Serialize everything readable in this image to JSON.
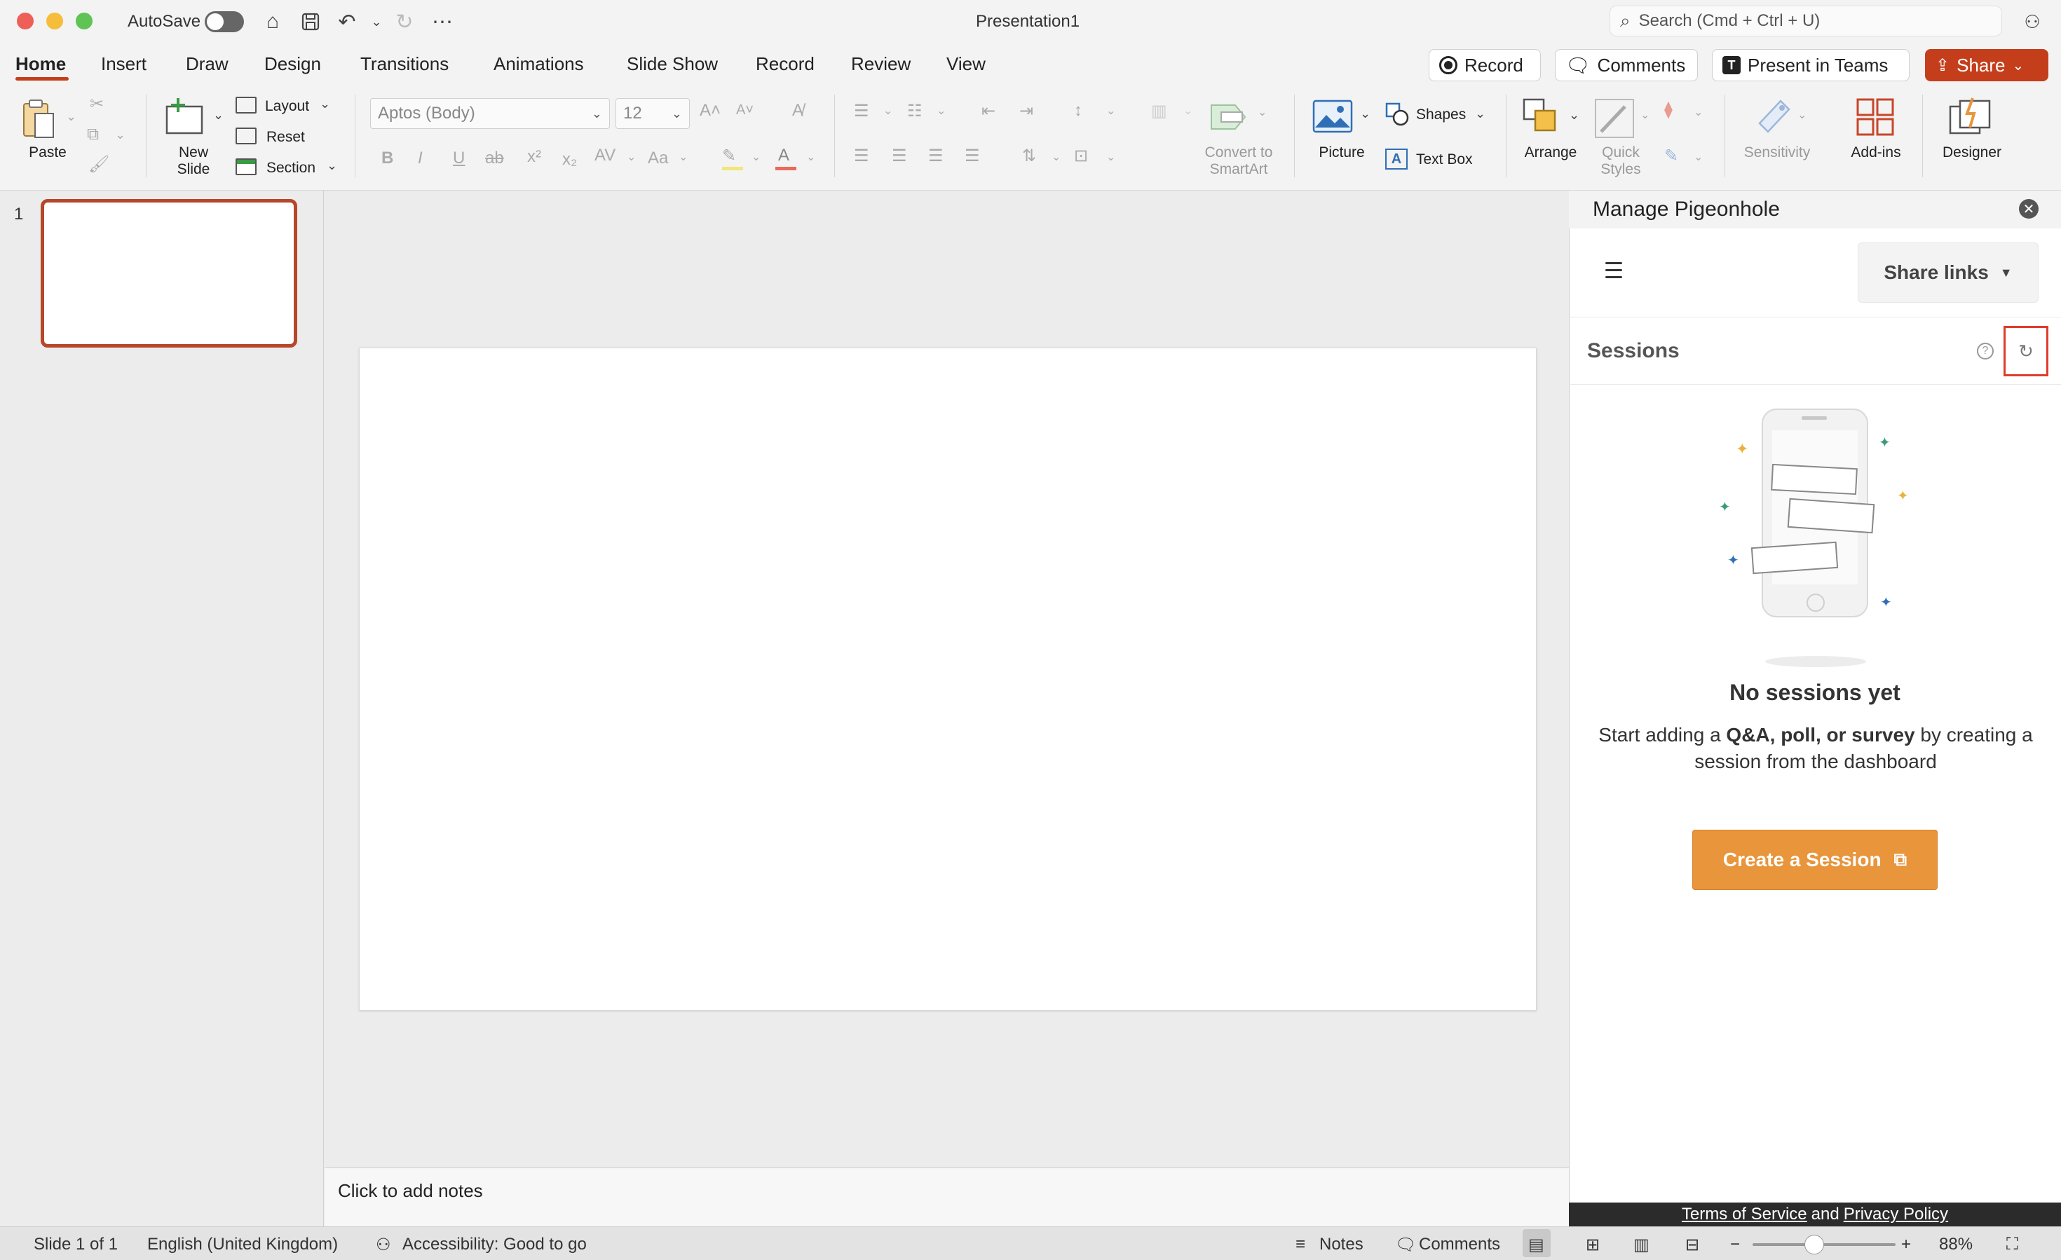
{
  "window": {
    "title": "Presentation1",
    "autosave_label": "AutoSave",
    "search_placeholder": "Search (Cmd + Ctrl + U)"
  },
  "tabs": [
    "Home",
    "Insert",
    "Draw",
    "Design",
    "Transitions",
    "Animations",
    "Slide Show",
    "Record",
    "Review",
    "View"
  ],
  "tab_actions": {
    "record": "Record",
    "comments": "Comments",
    "present_in_teams": "Present in Teams",
    "share": "Share"
  },
  "ribbon": {
    "paste": "Paste",
    "new_slide_1": "New",
    "new_slide_2": "Slide",
    "layout": "Layout",
    "reset": "Reset",
    "section": "Section",
    "font_name": "Aptos (Body)",
    "font_size": "12",
    "convert_1": "Convert to",
    "convert_2": "SmartArt",
    "picture": "Picture",
    "shapes": "Shapes",
    "text_box": "Text Box",
    "arrange": "Arrange",
    "quick_1": "Quick",
    "quick_2": "Styles",
    "sensitivity": "Sensitivity",
    "addins": "Add-ins",
    "designer": "Designer"
  },
  "thumbnails": {
    "slide_number": "1"
  },
  "notes": {
    "placeholder": "Click to add notes"
  },
  "pane": {
    "title": "Manage Pigeonhole",
    "share_links": "Share links",
    "sessions_title": "Sessions",
    "empty_title": "No sessions yet",
    "empty_desc_pre": "Start adding a ",
    "empty_desc_bold": "Q&A, poll, or survey",
    "empty_desc_post": " by creating a session from the dashboard",
    "create_button": "Create a Session",
    "terms": "Terms of Service ",
    "and": "and",
    "privacy": "Privacy Policy"
  },
  "status": {
    "slide_of": "Slide 1 of 1",
    "language": "English (United Kingdom)",
    "accessibility": "Accessibility: Good to go",
    "notes": "Notes",
    "comments": "Comments",
    "zoom": "88%",
    "zoom_level_percent": 88
  },
  "colors": {
    "accent": "#c43e1c",
    "create_button": "#e8953c",
    "highlight_box": "#e03b2b"
  }
}
